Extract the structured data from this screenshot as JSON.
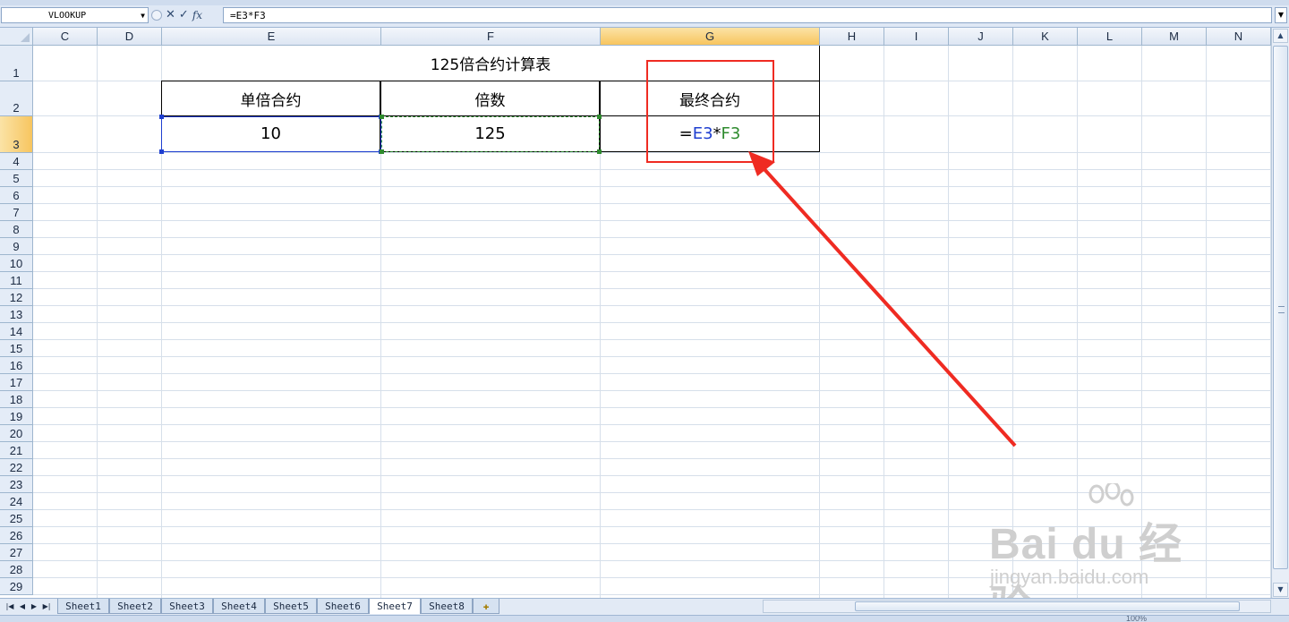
{
  "formula_bar": {
    "name_box": "VLOOKUP",
    "cancel_icon": "✕",
    "confirm_icon": "✓",
    "fx_label": "fx",
    "formula": "=E3*F3"
  },
  "columns": [
    "C",
    "D",
    "E",
    "F",
    "G",
    "H",
    "I",
    "J",
    "K",
    "L",
    "M",
    "N"
  ],
  "selected_column": "G",
  "rows": [
    "1",
    "2",
    "3",
    "4",
    "5",
    "6",
    "7",
    "8",
    "9",
    "10",
    "11",
    "12",
    "13",
    "14",
    "15",
    "16",
    "17",
    "18",
    "19",
    "20",
    "21",
    "22",
    "23",
    "24",
    "25",
    "26",
    "27",
    "28",
    "29"
  ],
  "selected_row": "3",
  "table": {
    "title": "125倍合约计算表",
    "headers": [
      "单倍合约",
      "倍数",
      "最终合约"
    ],
    "values": {
      "e3": "10",
      "f3": "125",
      "g3_formula": {
        "eq": "=",
        "ref1": "E3",
        "op": "*",
        "ref2": "F3"
      }
    }
  },
  "sheet_tabs": [
    "Sheet1",
    "Sheet2",
    "Sheet3",
    "Sheet4",
    "Sheet5",
    "Sheet6",
    "Sheet7",
    "Sheet8"
  ],
  "active_sheet": "Sheet7",
  "status": {
    "zoom": "100%"
  },
  "watermark": {
    "brand": "Bai du 经验",
    "url": "jingyan.baidu.com"
  },
  "annotation": {
    "color": "#ef2b22"
  },
  "colors": {
    "reference_blue": "#1f3fd0",
    "reference_green": "#2e8b2e",
    "header_highlight": "#f7c55f"
  }
}
